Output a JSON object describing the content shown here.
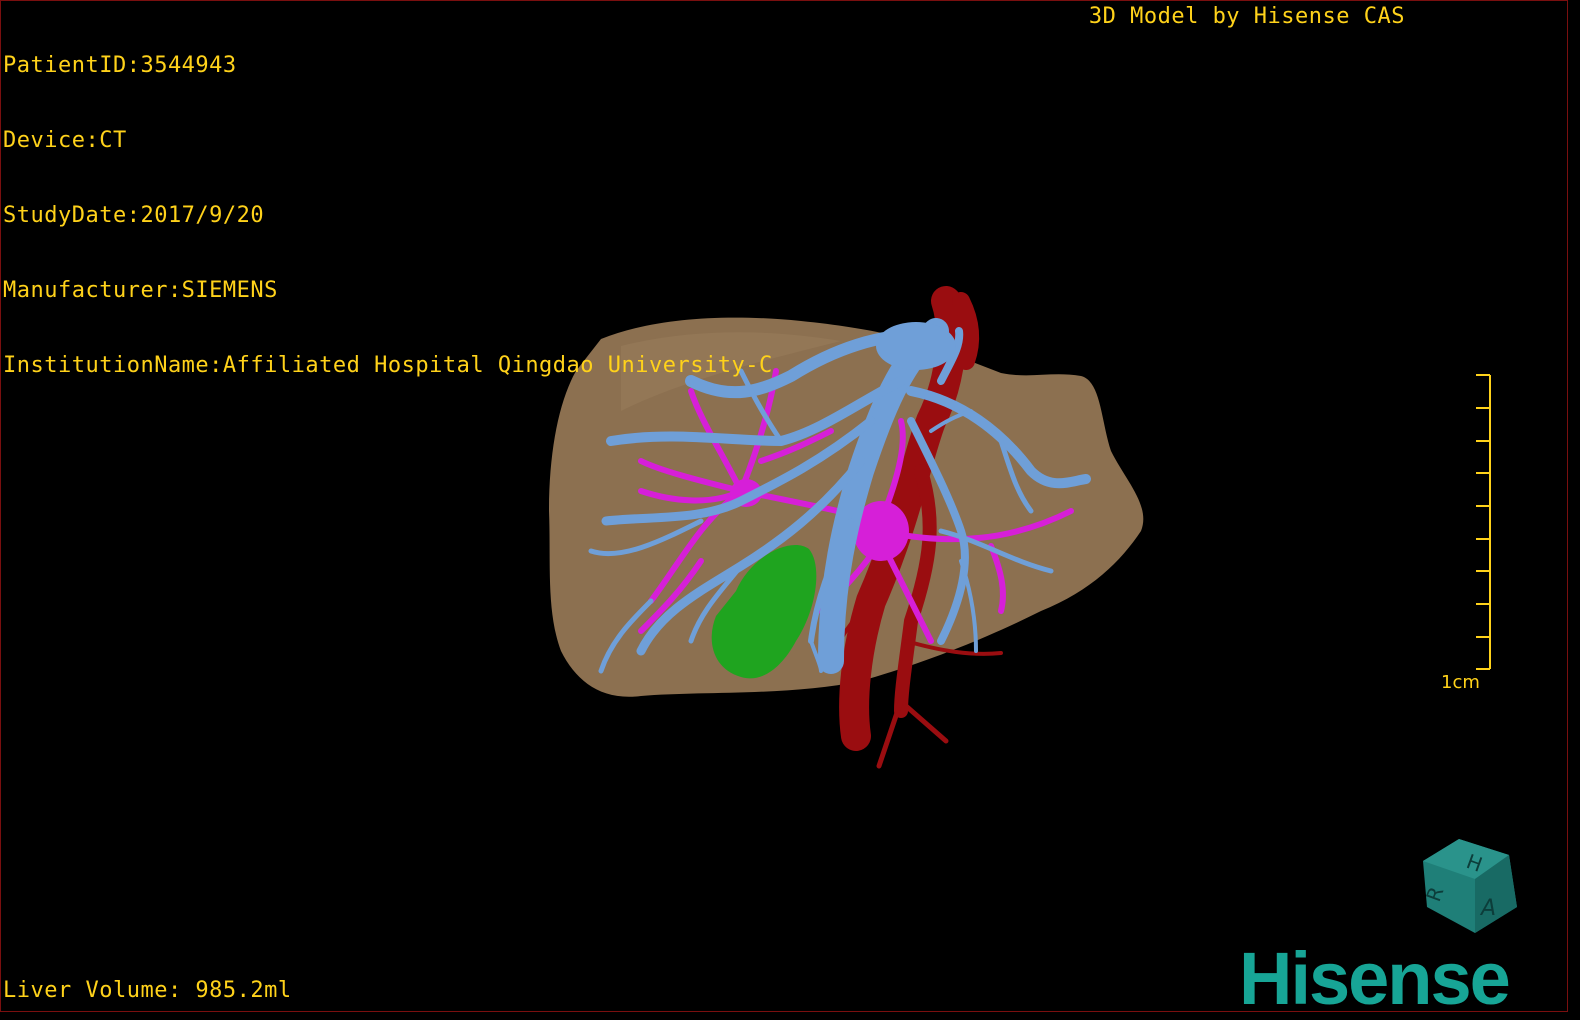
{
  "meta": {
    "patient": "PatientID:3544943",
    "device": "Device:CT",
    "study_date": "StudyDate:2017/9/20",
    "manufacturer": "Manufacturer:SIEMENS",
    "institution": "InstitutionName:Affiliated Hospital Qingdao University-C"
  },
  "credit": "3D Model by Hisense CAS",
  "volume": "Liver Volume: 985.2ml",
  "scale_bar": {
    "label": "1cm",
    "ticks": 10
  },
  "brand": "Hisense",
  "orientation_cube": {
    "faces": [
      "H",
      "R",
      "A"
    ],
    "color": "#1f7f78"
  },
  "colors": {
    "text": "#ffd21a",
    "liver": "#8c7050",
    "portal_vein": "#6f9fd8",
    "hepatic_vessel": "#d61fd8",
    "artery": "#9a0d10",
    "gallbladder": "#1fa41f",
    "brand": "#17a596"
  }
}
